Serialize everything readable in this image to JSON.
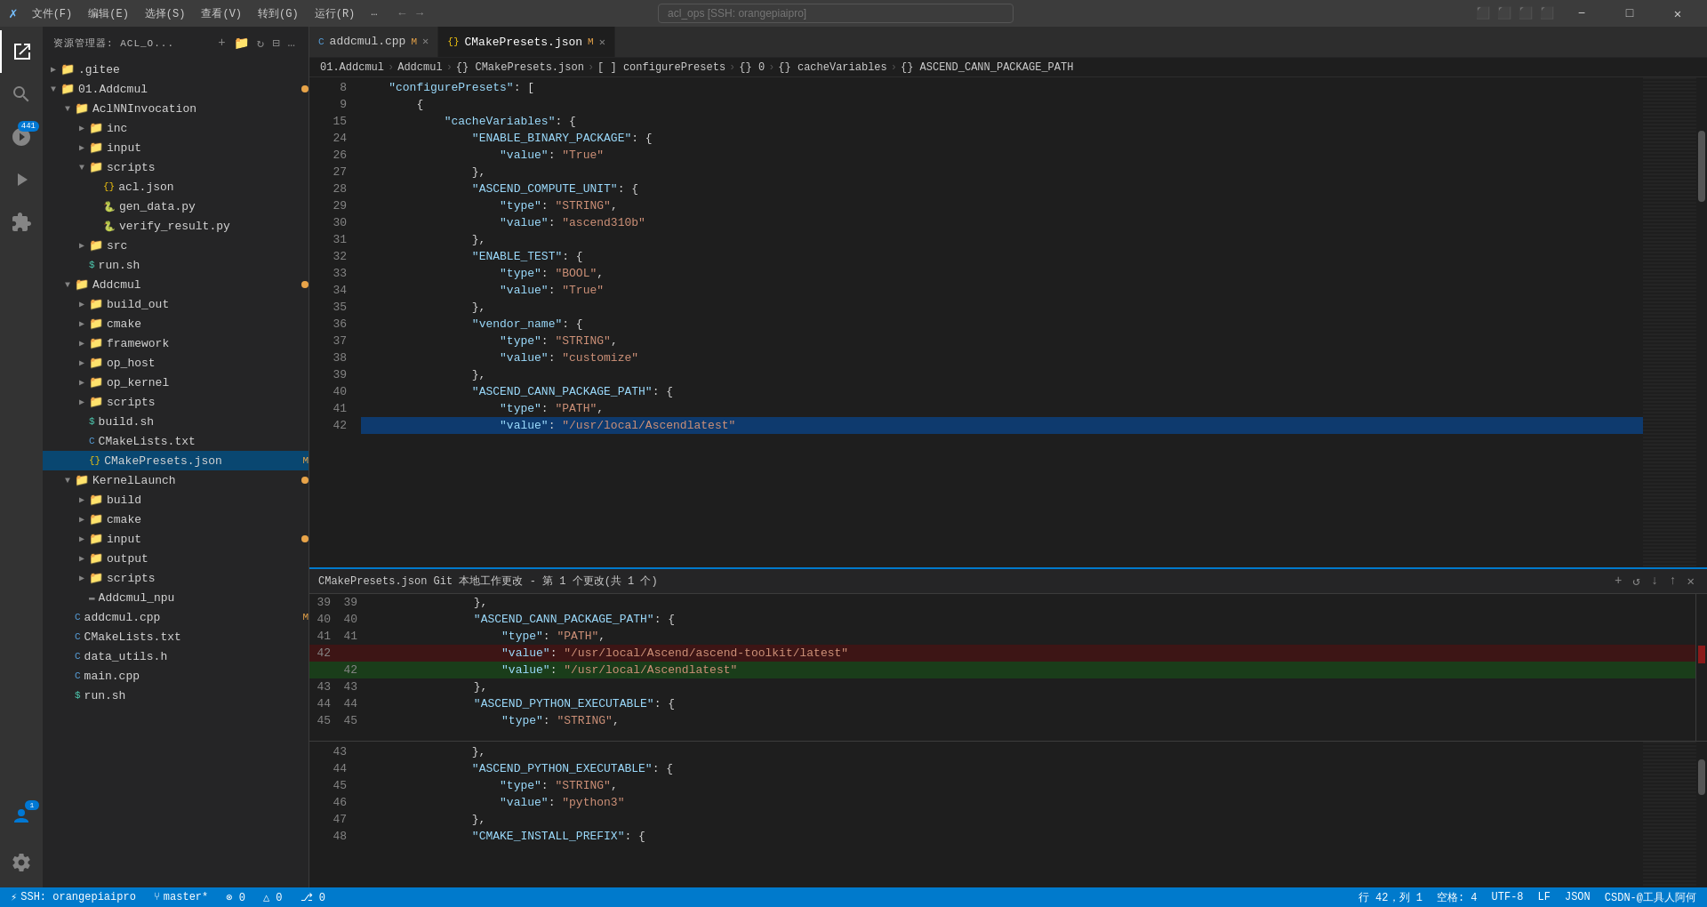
{
  "titlebar": {
    "icon": "✗",
    "menus": [
      "文件(F)",
      "编辑(E)",
      "选择(S)",
      "查看(V)",
      "转到(G)",
      "运行(R)",
      "…"
    ],
    "search_placeholder": "acl_ops [SSH: orangepiaipro]",
    "nav_back": "←",
    "nav_fwd": "→",
    "btn_layout1": "⬜",
    "btn_layout2": "⬜",
    "btn_layout3": "⬜",
    "btn_layout4": "⬜",
    "btn_minimize": "−",
    "btn_maximize": "□",
    "btn_close": "✕"
  },
  "sidebar": {
    "header": "资源管理器: ACL_O...",
    "tree": [
      {
        "id": "gitee",
        "label": ".gitee",
        "type": "folder",
        "depth": 0,
        "expanded": false
      },
      {
        "id": "addcmul",
        "label": "01.Addcmul",
        "type": "folder",
        "depth": 0,
        "expanded": true,
        "modified": true
      },
      {
        "id": "aclnninvocation",
        "label": "AclNNInvocation",
        "type": "folder",
        "depth": 1,
        "expanded": true
      },
      {
        "id": "inc",
        "label": "inc",
        "type": "folder",
        "depth": 2,
        "expanded": false
      },
      {
        "id": "input",
        "label": "input",
        "type": "folder",
        "depth": 2,
        "expanded": false
      },
      {
        "id": "scripts",
        "label": "scripts",
        "type": "folder",
        "depth": 2,
        "expanded": false
      },
      {
        "id": "acljson",
        "label": "acl.json",
        "type": "file-json",
        "depth": 3,
        "expanded": false
      },
      {
        "id": "gendata",
        "label": "gen_data.py",
        "type": "file-py",
        "depth": 3
      },
      {
        "id": "verifyresult",
        "label": "verify_result.py",
        "type": "file-py",
        "depth": 3
      },
      {
        "id": "src",
        "label": "src",
        "type": "folder",
        "depth": 2,
        "expanded": false
      },
      {
        "id": "runsh",
        "label": "run.sh",
        "type": "file-sh",
        "depth": 2
      },
      {
        "id": "addcmul2",
        "label": "Addcmul",
        "type": "folder",
        "depth": 1,
        "expanded": true,
        "modified": true
      },
      {
        "id": "buildout",
        "label": "build_out",
        "type": "folder",
        "depth": 2,
        "expanded": false
      },
      {
        "id": "cmake",
        "label": "cmake",
        "type": "folder",
        "depth": 2,
        "expanded": false
      },
      {
        "id": "framework",
        "label": "framework",
        "type": "folder",
        "depth": 2,
        "expanded": false
      },
      {
        "id": "ophost",
        "label": "op_host",
        "type": "folder",
        "depth": 2,
        "expanded": false
      },
      {
        "id": "opkernel",
        "label": "op_kernel",
        "type": "folder",
        "depth": 2,
        "expanded": false
      },
      {
        "id": "scripts2",
        "label": "scripts",
        "type": "folder",
        "depth": 2,
        "expanded": false
      },
      {
        "id": "buildsh",
        "label": "build.sh",
        "type": "file-sh",
        "depth": 2
      },
      {
        "id": "cmakelists",
        "label": "CMakeLists.txt",
        "type": "file-c",
        "depth": 2
      },
      {
        "id": "cmakepresets",
        "label": "CMakePresets.json",
        "type": "file-json",
        "depth": 2,
        "modified": true,
        "selected": true
      },
      {
        "id": "kernellaunch",
        "label": "KernelLaunch",
        "type": "folder",
        "depth": 1,
        "expanded": true,
        "modified": true
      },
      {
        "id": "build2",
        "label": "build",
        "type": "folder",
        "depth": 2,
        "expanded": false
      },
      {
        "id": "cmake2",
        "label": "cmake",
        "type": "folder",
        "depth": 2,
        "expanded": false
      },
      {
        "id": "input2",
        "label": "input",
        "type": "folder",
        "depth": 2,
        "expanded": false,
        "modified": true
      },
      {
        "id": "output",
        "label": "output",
        "type": "folder",
        "depth": 2,
        "expanded": false
      },
      {
        "id": "scripts3",
        "label": "scripts",
        "type": "folder",
        "depth": 2,
        "expanded": false
      },
      {
        "id": "addcmulnpu",
        "label": "Addcmul_npu",
        "type": "file",
        "depth": 2
      },
      {
        "id": "addcmulcpp",
        "label": "addcmul.cpp",
        "type": "file-c",
        "depth": 1,
        "modified_m": "M"
      },
      {
        "id": "cmakelists2",
        "label": "CMakeLists.txt",
        "type": "file-c",
        "depth": 1
      },
      {
        "id": "datautils",
        "label": "data_utils.h",
        "type": "file-c",
        "depth": 1
      },
      {
        "id": "maincpp",
        "label": "main.cpp",
        "type": "file-c",
        "depth": 1
      },
      {
        "id": "runsh2",
        "label": "run.sh",
        "type": "file-sh",
        "depth": 1
      }
    ]
  },
  "tabs": [
    {
      "id": "addcmul-tab",
      "label": "addcmul.cpp",
      "modified": "M",
      "active": false,
      "icon": "C"
    },
    {
      "id": "cmakepresets-tab",
      "label": "CMakePresets.json",
      "modified": "M",
      "active": true,
      "icon": "{}"
    }
  ],
  "breadcrumb": [
    "01.Addcmul",
    "Addcmul",
    "{} CMakePresets.json",
    "[ ] configurePresets",
    "{} 0",
    "{} cacheVariables",
    "{} ASCEND_CANN_PACKAGE_PATH"
  ],
  "editor": {
    "lines": [
      {
        "num": 8,
        "tokens": [
          {
            "t": "    \"configurePresets\": [",
            "c": "json-key"
          }
        ]
      },
      {
        "num": 9,
        "tokens": [
          {
            "t": "        {",
            "c": "json-brace"
          }
        ]
      },
      {
        "num": 15,
        "tokens": [
          {
            "t": "            \"cacheVariables\": {",
            "c": "json-key"
          }
        ]
      },
      {
        "num": 24,
        "tokens": [
          {
            "t": "                \"ENABLE_BINARY_PACKAGE\": {",
            "c": "json-key"
          }
        ]
      },
      {
        "num": 26,
        "tokens": [
          {
            "t": "                    \"value\": \"True\"",
            "c": ""
          }
        ]
      },
      {
        "num": 27,
        "tokens": [
          {
            "t": "                },",
            "c": ""
          }
        ]
      },
      {
        "num": 28,
        "tokens": [
          {
            "t": "                \"ASCEND_COMPUTE_UNIT\": {",
            "c": "json-key"
          }
        ]
      },
      {
        "num": 29,
        "tokens": [
          {
            "t": "                    \"type\": \"STRING\",",
            "c": ""
          }
        ]
      },
      {
        "num": 30,
        "tokens": [
          {
            "t": "                    \"value\": \"ascend310b\"",
            "c": ""
          }
        ]
      },
      {
        "num": 31,
        "tokens": [
          {
            "t": "                },",
            "c": ""
          }
        ]
      },
      {
        "num": 32,
        "tokens": [
          {
            "t": "                \"ENABLE_TEST\": {",
            "c": "json-key"
          }
        ]
      },
      {
        "num": 33,
        "tokens": [
          {
            "t": "                    \"type\": \"BOOL\",",
            "c": ""
          }
        ]
      },
      {
        "num": 34,
        "tokens": [
          {
            "t": "                    \"value\": \"True\"",
            "c": ""
          }
        ]
      },
      {
        "num": 35,
        "tokens": [
          {
            "t": "                },",
            "c": ""
          }
        ]
      },
      {
        "num": 36,
        "tokens": [
          {
            "t": "                \"vendor_name\": {",
            "c": "json-key"
          }
        ]
      },
      {
        "num": 37,
        "tokens": [
          {
            "t": "                    \"type\": \"STRING\",",
            "c": ""
          }
        ]
      },
      {
        "num": 38,
        "tokens": [
          {
            "t": "                    \"value\": \"customize\"",
            "c": ""
          }
        ]
      },
      {
        "num": 39,
        "tokens": [
          {
            "t": "                },",
            "c": ""
          }
        ]
      },
      {
        "num": 40,
        "tokens": [
          {
            "t": "                \"ASCEND_CANN_PACKAGE_PATH\": {",
            "c": "json-key"
          }
        ]
      },
      {
        "num": 41,
        "tokens": [
          {
            "t": "                    \"type\": \"PATH\",",
            "c": ""
          }
        ]
      },
      {
        "num": 42,
        "tokens": [
          {
            "t": "                    \"value\": \"/usr/local/Ascendlatest\"",
            "c": ""
          }
        ]
      },
      {
        "num": 42,
        "tokens": [
          {
            "t": "}",
            "c": ""
          }
        ]
      }
    ]
  },
  "diff": {
    "header": "CMakePresets.json  Git 本地工作更改 - 第 1 个更改(共 1 个)",
    "left_lines": [
      {
        "num1": 39,
        "num2": 39,
        "text": "                },",
        "type": "normal"
      },
      {
        "num1": 40,
        "num2": 40,
        "text": "                \"ASCEND_CANN_PACKAGE_PATH\": {",
        "type": "normal"
      },
      {
        "num1": 41,
        "num2": 41,
        "text": "                    \"type\": \"PATH\",",
        "type": "normal"
      },
      {
        "num1": 42,
        "num2": "",
        "text": "                    \"value\": \"/usr/local/Ascend/ascend-toolkit/latest\"",
        "type": "removed"
      },
      {
        "num1": "",
        "num2": 42,
        "text": "                    \"value\": \"/usr/local/Ascendlatest\"",
        "type": "added"
      },
      {
        "num1": 43,
        "num2": 43,
        "text": "                },",
        "type": "normal"
      },
      {
        "num1": 44,
        "num2": 44,
        "text": "                \"ASCEND_PYTHON_EXECUTABLE\": {",
        "type": "normal"
      },
      {
        "num1": 45,
        "num2": 45,
        "text": "                    \"type\": \"STRING\",",
        "type": "normal"
      }
    ]
  },
  "lower_editor": {
    "lines": [
      {
        "num": 43,
        "text": "                },"
      },
      {
        "num": 44,
        "text": "                \"ASCEND_PYTHON_EXECUTABLE\": {"
      },
      {
        "num": 45,
        "text": "                    \"type\": \"STRING\","
      },
      {
        "num": 46,
        "text": "                    \"value\": \"python3\""
      },
      {
        "num": 47,
        "text": "                },"
      },
      {
        "num": 48,
        "text": "                \"CMAKE_INSTALL_PREFIX\": {"
      }
    ]
  },
  "statusbar": {
    "ssh": "SSH: orangepiaipro",
    "git": "master*",
    "errors": "⊗ 0",
    "warnings": "△ 0",
    "git_changes": "⎇ 0",
    "cursor": "行 42，列 1",
    "spaces": "空格: 4",
    "encoding": "UTF-8",
    "line_ending": "LF",
    "language": "JSON",
    "feedback": "CSDN-@工具人阿何"
  },
  "activity": {
    "explorer_label": "Explorer",
    "search_label": "Search",
    "git_label": "Source Control",
    "run_label": "Run",
    "extensions_label": "Extensions",
    "badge": "441"
  }
}
